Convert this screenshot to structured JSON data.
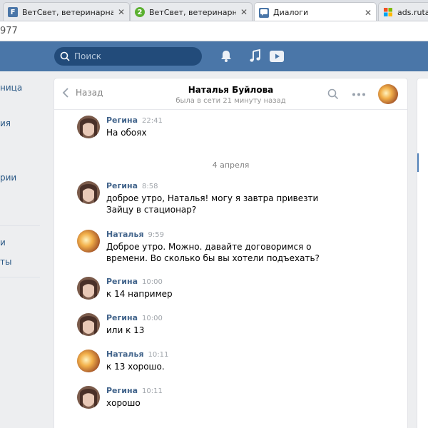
{
  "browser": {
    "tabs": [
      {
        "title": "ВетСвет, ветеринарная к",
        "icon": "vk-app-favicon-icon",
        "color": "#4a76a8",
        "glyph": "F",
        "active": false
      },
      {
        "title": "ВетСвет, ветеринарная к",
        "icon": "green-2-favicon-icon",
        "color": "#5bb030",
        "glyph": "2",
        "active": false
      },
      {
        "title": "Диалоги",
        "icon": "vk-messages-favicon-icon",
        "color": "#4a76a8",
        "glyph": "",
        "active": true
      },
      {
        "title": "ads.rutaxi",
        "icon": "windows-favicon-icon",
        "color": "#f25022",
        "glyph": "",
        "active": false
      }
    ],
    "url": "977"
  },
  "header": {
    "search_placeholder": "Поиск",
    "icons": [
      "bell-icon",
      "music-note-icon",
      "video-play-icon"
    ]
  },
  "left_menu": {
    "items": [
      "ница",
      "ия",
      "рии",
      "и",
      "ты"
    ]
  },
  "dialog": {
    "back_label": "Назад",
    "peer_name": "Наталья Буйлова",
    "peer_status": "была в сети 21 минуту назад",
    "date_separator": "4 апреля",
    "messages": [
      {
        "author": "Регина",
        "time": "22:41",
        "text": "На обоях",
        "avatar": "regina"
      },
      {
        "author": "Регина",
        "time": "8:58",
        "text": "доброе утро, Наталья! могу я завтра привезти Зайцу в стационар?",
        "avatar": "regina"
      },
      {
        "author": "Наталья",
        "time": "9:59",
        "text": "Доброе утро. Можно. давайте договоримся о времени. Во сколько бы вы хотели подъехать?",
        "avatar": "natalia"
      },
      {
        "author": "Регина",
        "time": "10:00",
        "text": "к 14 например",
        "avatar": "regina"
      },
      {
        "author": "Регина",
        "time": "10:00",
        "text": "или к 13",
        "avatar": "regina"
      },
      {
        "author": "Наталья",
        "time": "10:11",
        "text": "к 13 хорошо.",
        "avatar": "natalia"
      },
      {
        "author": "Регина",
        "time": "10:11",
        "text": "хорошо",
        "avatar": "regina"
      }
    ]
  },
  "colors": {
    "vk_blue": "#4a76a8",
    "link_blue": "#42648b",
    "page_bg": "#edeef0"
  }
}
